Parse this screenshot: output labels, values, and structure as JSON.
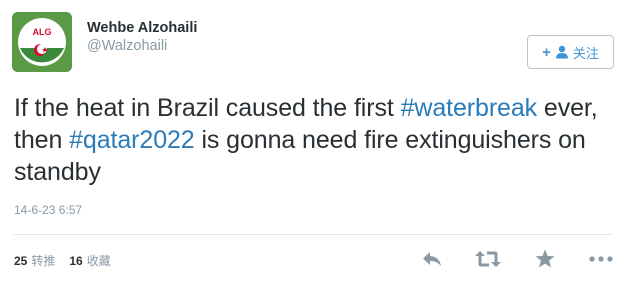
{
  "user": {
    "name": "Wehbe Alzohaili",
    "handle": "@Walzohaili",
    "avatar_label": "ALG"
  },
  "follow_button": {
    "label": "关注",
    "icon": "add-user-icon"
  },
  "tweet": {
    "segments": [
      {
        "type": "text",
        "text": "If the heat in Brazil caused the first "
      },
      {
        "type": "hashtag",
        "text": "#waterbreak"
      },
      {
        "type": "text",
        "text": " ever, then "
      },
      {
        "type": "hashtag",
        "text": "#qatar2022"
      },
      {
        "type": "text",
        "text": " is gonna need fire extinguishers on standby"
      }
    ],
    "timestamp": "14-6-23 6:57"
  },
  "stats": {
    "retweets_count": "25",
    "retweets_label": "转推",
    "favorites_count": "16",
    "favorites_label": "收藏"
  },
  "actions": [
    "reply-icon",
    "retweet-icon",
    "favorite-icon",
    "more-icon"
  ],
  "colors": {
    "hashtag": "#2b7bb9",
    "follow_text": "#3b94d9",
    "muted": "#8899a6",
    "text": "#292f33",
    "icon": "#8899a6",
    "avatar_green": "#4e8d3c"
  }
}
